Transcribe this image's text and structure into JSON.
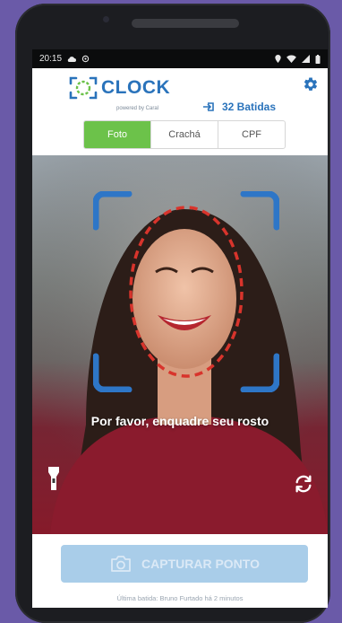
{
  "status_bar": {
    "time": "20:15"
  },
  "header": {
    "brand": "CLOCK",
    "powered_by": "powered by Caral",
    "batidas_label": "32 Batidas"
  },
  "tabs": [
    {
      "label": "Foto",
      "active": true
    },
    {
      "label": "Crachá",
      "active": false
    },
    {
      "label": "CPF",
      "active": false
    }
  ],
  "camera": {
    "prompt": "Por favor, enquadre seu rosto"
  },
  "footer": {
    "capture_label": "CAPTURAR PONTO",
    "last_punch": "Última batida: Bruno Furtado há 2 minutos"
  },
  "colors": {
    "brand_blue": "#2a73bb",
    "tab_active_green": "#6cc24a",
    "capture_disabled": "#a9cde9",
    "face_frame_blue": "#2e76c7",
    "face_guide_red": "#d8342c"
  },
  "icons": {
    "settings": "gear-icon",
    "batidas": "punch-in-icon",
    "flashlight": "flashlight-icon",
    "switch_camera": "switch-camera-icon",
    "capture": "camera-icon"
  }
}
